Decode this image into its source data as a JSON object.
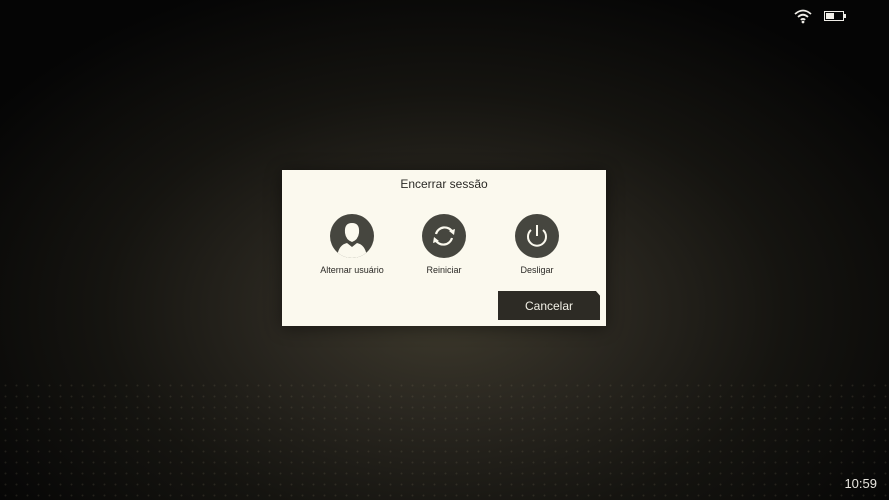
{
  "status": {
    "time": "10:59",
    "wifi_icon": "wifi-icon",
    "battery_icon": "battery-icon"
  },
  "dialog": {
    "title": "Encerrar sessão",
    "options": [
      {
        "label": "Alternar usuário",
        "icon": "user-icon"
      },
      {
        "label": "Reiniciar",
        "icon": "restart-icon"
      },
      {
        "label": "Desligar",
        "icon": "power-icon"
      }
    ],
    "cancel_label": "Cancelar"
  },
  "colors": {
    "dialog_bg": "#fbf9ee",
    "icon_circle": "#46463f",
    "button_bg": "#2d2b25",
    "text_dark": "#2b2a26"
  }
}
